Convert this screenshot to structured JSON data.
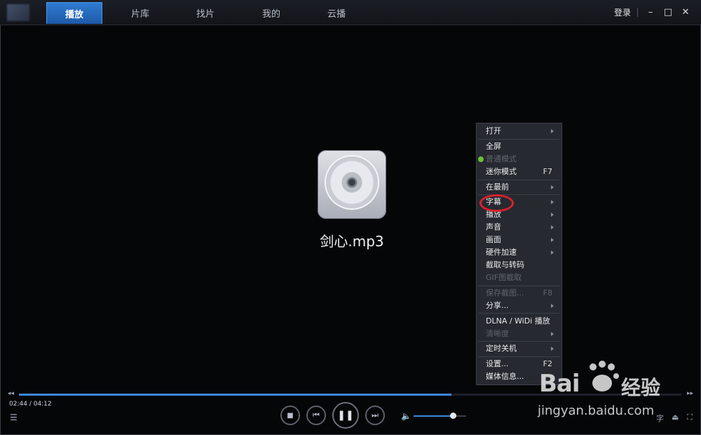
{
  "header": {
    "tabs": [
      {
        "label": "播放",
        "active": true
      },
      {
        "label": "片库",
        "active": false
      },
      {
        "label": "找片",
        "active": false
      },
      {
        "label": "我的",
        "active": false
      },
      {
        "label": "云播",
        "active": false
      }
    ],
    "login_label": "登录",
    "window_buttons": {
      "minimize": "–",
      "maximize": "□",
      "close": "✕"
    }
  },
  "media": {
    "file_name": "剑心.mp3"
  },
  "context_menu": {
    "items": [
      {
        "label": "打开",
        "shortcut": "",
        "submenu": true,
        "enabled": true
      },
      {
        "label": "全屏",
        "shortcut": "",
        "submenu": false,
        "enabled": true
      },
      {
        "label": "普通模式",
        "shortcut": "",
        "submenu": false,
        "enabled": false
      },
      {
        "label": "迷你模式",
        "shortcut": "F7",
        "submenu": false,
        "enabled": true
      },
      {
        "label": "在最前",
        "shortcut": "",
        "submenu": true,
        "enabled": true
      },
      {
        "label": "字幕",
        "shortcut": "",
        "submenu": true,
        "enabled": true
      },
      {
        "label": "播放",
        "shortcut": "",
        "submenu": true,
        "enabled": true
      },
      {
        "label": "声音",
        "shortcut": "",
        "submenu": true,
        "enabled": true
      },
      {
        "label": "画面",
        "shortcut": "",
        "submenu": true,
        "enabled": true
      },
      {
        "label": "硬件加速",
        "shortcut": "",
        "submenu": true,
        "enabled": true
      },
      {
        "label": "截取与转码",
        "shortcut": "",
        "submenu": false,
        "enabled": true
      },
      {
        "label": "GIF图截取",
        "shortcut": "",
        "submenu": false,
        "enabled": false
      },
      {
        "label": "保存截图...",
        "shortcut": "F8",
        "submenu": false,
        "enabled": false
      },
      {
        "label": "分享...",
        "shortcut": "",
        "submenu": true,
        "enabled": true
      },
      {
        "label": "DLNA / WiDi 播放",
        "shortcut": "",
        "submenu": false,
        "enabled": true
      },
      {
        "label": "清晰度",
        "shortcut": "",
        "submenu": true,
        "enabled": false
      },
      {
        "label": "定时关机",
        "shortcut": "",
        "submenu": true,
        "enabled": true
      },
      {
        "label": "设置...",
        "shortcut": "F2",
        "submenu": false,
        "enabled": true
      },
      {
        "label": "媒体信息...",
        "shortcut": "",
        "submenu": false,
        "enabled": true
      }
    ],
    "highlighted_item": "字幕",
    "colors": {
      "background": "#262930",
      "highlight_ring": "#d9202c",
      "active_dot": "#6cbf3a"
    }
  },
  "player": {
    "time_display": "02:44 / 04:12",
    "progress": 0.653,
    "volume": 0.7,
    "accent": "#3f86d9"
  },
  "icons": {
    "seek_back": "◂◂",
    "seek_forward": "▸▸",
    "playlist": "list-icon",
    "stop": "■",
    "prev": "⏮",
    "pause": "❚❚",
    "next": "⏭",
    "volume": "speaker-icon"
  },
  "watermark": {
    "brand_word": "Bai",
    "brand_cn": "经验",
    "url": "jingyan.baidu.com"
  }
}
